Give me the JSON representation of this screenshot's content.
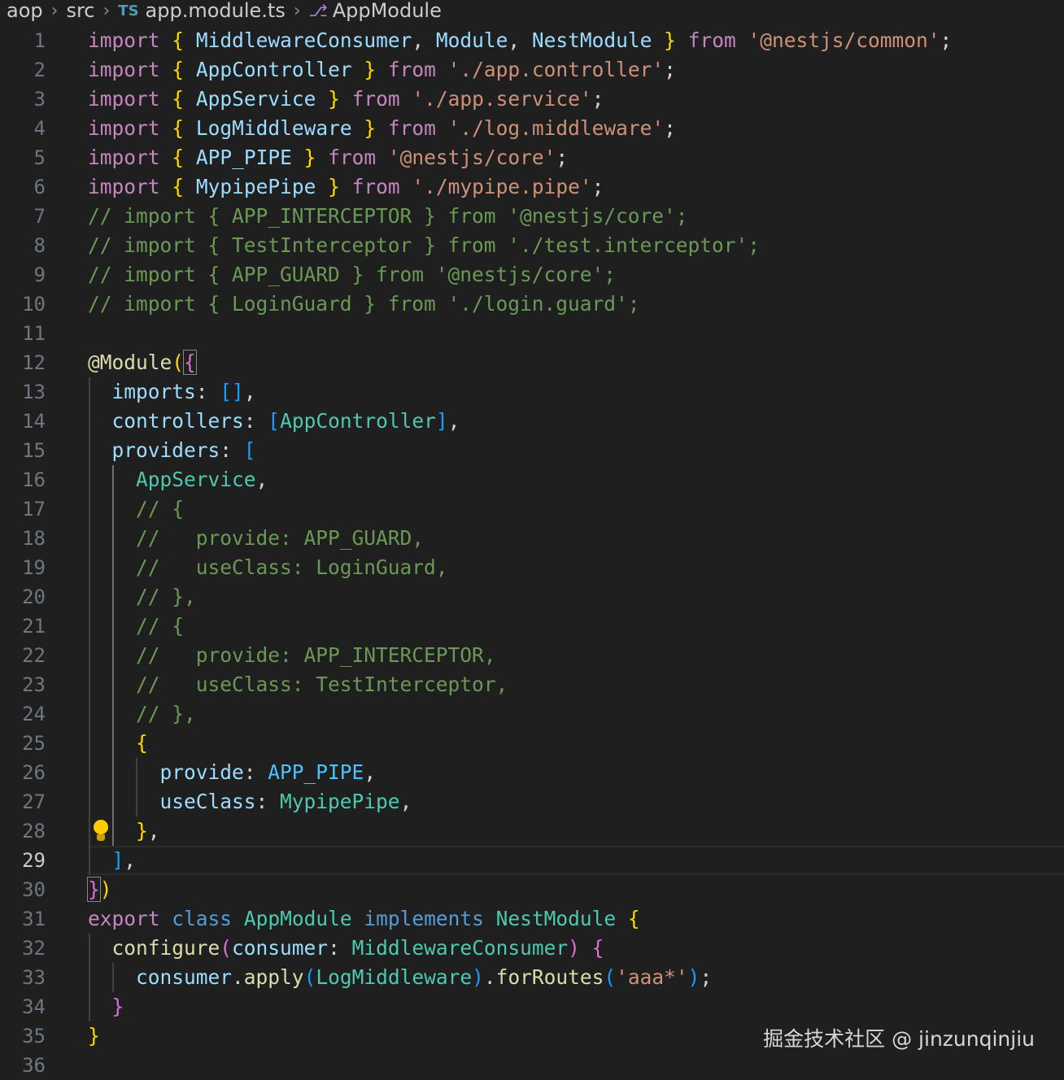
{
  "breadcrumb": {
    "items": [
      "aop",
      "src",
      "app.module.ts",
      "AppModule"
    ],
    "separator": ">",
    "file_badge": "TS"
  },
  "editor": {
    "current_line": 29,
    "lightbulb_line": 28,
    "colors": {
      "background": "#1f1f1f",
      "keyword": "#c586c0",
      "type": "#4ec9b0",
      "variable": "#9cdcfe",
      "string": "#ce9178",
      "comment": "#6a9955",
      "function": "#dcdcaa"
    },
    "lines": [
      {
        "n": 1,
        "tokens": [
          [
            "k",
            "import"
          ],
          [
            "d",
            " "
          ],
          [
            "b1",
            "{"
          ],
          [
            "d",
            " "
          ],
          [
            "v",
            "MiddlewareConsumer"
          ],
          [
            "d",
            ", "
          ],
          [
            "v",
            "Module"
          ],
          [
            "d",
            ", "
          ],
          [
            "v",
            "NestModule"
          ],
          [
            "d",
            " "
          ],
          [
            "b1",
            "}"
          ],
          [
            "d",
            " "
          ],
          [
            "k",
            "from"
          ],
          [
            "d",
            " "
          ],
          [
            "s",
            "'@nestjs/common'"
          ],
          [
            "d",
            ";"
          ]
        ]
      },
      {
        "n": 2,
        "tokens": [
          [
            "k",
            "import"
          ],
          [
            "d",
            " "
          ],
          [
            "b1",
            "{"
          ],
          [
            "d",
            " "
          ],
          [
            "v",
            "AppController"
          ],
          [
            "d",
            " "
          ],
          [
            "b1",
            "}"
          ],
          [
            "d",
            " "
          ],
          [
            "k",
            "from"
          ],
          [
            "d",
            " "
          ],
          [
            "s",
            "'./app.controller'"
          ],
          [
            "d",
            ";"
          ]
        ]
      },
      {
        "n": 3,
        "tokens": [
          [
            "k",
            "import"
          ],
          [
            "d",
            " "
          ],
          [
            "b1",
            "{"
          ],
          [
            "d",
            " "
          ],
          [
            "v",
            "AppService"
          ],
          [
            "d",
            " "
          ],
          [
            "b1",
            "}"
          ],
          [
            "d",
            " "
          ],
          [
            "k",
            "from"
          ],
          [
            "d",
            " "
          ],
          [
            "s",
            "'./app.service'"
          ],
          [
            "d",
            ";"
          ]
        ]
      },
      {
        "n": 4,
        "tokens": [
          [
            "k",
            "import"
          ],
          [
            "d",
            " "
          ],
          [
            "b1",
            "{"
          ],
          [
            "d",
            " "
          ],
          [
            "v",
            "LogMiddleware"
          ],
          [
            "d",
            " "
          ],
          [
            "b1",
            "}"
          ],
          [
            "d",
            " "
          ],
          [
            "k",
            "from"
          ],
          [
            "d",
            " "
          ],
          [
            "s",
            "'./log.middleware'"
          ],
          [
            "d",
            ";"
          ]
        ]
      },
      {
        "n": 5,
        "tokens": [
          [
            "k",
            "import"
          ],
          [
            "d",
            " "
          ],
          [
            "b1",
            "{"
          ],
          [
            "d",
            " "
          ],
          [
            "v",
            "APP_PIPE"
          ],
          [
            "d",
            " "
          ],
          [
            "b1",
            "}"
          ],
          [
            "d",
            " "
          ],
          [
            "k",
            "from"
          ],
          [
            "d",
            " "
          ],
          [
            "s",
            "'@nestjs/core'"
          ],
          [
            "d",
            ";"
          ]
        ]
      },
      {
        "n": 6,
        "tokens": [
          [
            "k",
            "import"
          ],
          [
            "d",
            " "
          ],
          [
            "b1",
            "{"
          ],
          [
            "d",
            " "
          ],
          [
            "v",
            "MypipePipe"
          ],
          [
            "d",
            " "
          ],
          [
            "b1",
            "}"
          ],
          [
            "d",
            " "
          ],
          [
            "k",
            "from"
          ],
          [
            "d",
            " "
          ],
          [
            "s",
            "'./mypipe.pipe'"
          ],
          [
            "d",
            ";"
          ]
        ]
      },
      {
        "n": 7,
        "tokens": [
          [
            "cm",
            "// import { APP_INTERCEPTOR } from '@nestjs/core';"
          ]
        ]
      },
      {
        "n": 8,
        "tokens": [
          [
            "cm",
            "// import { TestInterceptor } from './test.interceptor';"
          ]
        ]
      },
      {
        "n": 9,
        "tokens": [
          [
            "cm",
            "// import { APP_GUARD } from '@nestjs/core';"
          ]
        ]
      },
      {
        "n": 10,
        "tokens": [
          [
            "cm",
            "// import { LoginGuard } from './login.guard';"
          ]
        ]
      },
      {
        "n": 11,
        "tokens": []
      },
      {
        "n": 12,
        "tokens": [
          [
            "f",
            "@Module"
          ],
          [
            "b1",
            "("
          ],
          [
            "b2 match",
            "{"
          ]
        ]
      },
      {
        "n": 13,
        "guides": [
          1
        ],
        "tokens": [
          [
            "d",
            "  "
          ],
          [
            "v",
            "imports"
          ],
          [
            "d",
            ": "
          ],
          [
            "b3",
            "[]"
          ],
          [
            "d",
            ","
          ]
        ]
      },
      {
        "n": 14,
        "guides": [
          1
        ],
        "tokens": [
          [
            "d",
            "  "
          ],
          [
            "v",
            "controllers"
          ],
          [
            "d",
            ": "
          ],
          [
            "b3",
            "["
          ],
          [
            "t",
            "AppController"
          ],
          [
            "b3",
            "]"
          ],
          [
            "d",
            ","
          ]
        ]
      },
      {
        "n": 15,
        "guides": [
          1
        ],
        "tokens": [
          [
            "d",
            "  "
          ],
          [
            "v",
            "providers"
          ],
          [
            "d",
            ": "
          ],
          [
            "b3",
            "["
          ]
        ]
      },
      {
        "n": 16,
        "guides": [
          1,
          2
        ],
        "tokens": [
          [
            "d",
            "    "
          ],
          [
            "t",
            "AppService"
          ],
          [
            "d",
            ","
          ]
        ]
      },
      {
        "n": 17,
        "guides": [
          1,
          2
        ],
        "tokens": [
          [
            "d",
            "    "
          ],
          [
            "cm",
            "// {"
          ]
        ]
      },
      {
        "n": 18,
        "guides": [
          1,
          2
        ],
        "tokens": [
          [
            "d",
            "    "
          ],
          [
            "cm",
            "//   provide: APP_GUARD,"
          ]
        ]
      },
      {
        "n": 19,
        "guides": [
          1,
          2
        ],
        "tokens": [
          [
            "d",
            "    "
          ],
          [
            "cm",
            "//   useClass: LoginGuard,"
          ]
        ]
      },
      {
        "n": 20,
        "guides": [
          1,
          2
        ],
        "tokens": [
          [
            "d",
            "    "
          ],
          [
            "cm",
            "// },"
          ]
        ]
      },
      {
        "n": 21,
        "guides": [
          1,
          2
        ],
        "tokens": [
          [
            "d",
            "    "
          ],
          [
            "cm",
            "// {"
          ]
        ]
      },
      {
        "n": 22,
        "guides": [
          1,
          2
        ],
        "tokens": [
          [
            "d",
            "    "
          ],
          [
            "cm",
            "//   provide: APP_INTERCEPTOR,"
          ]
        ]
      },
      {
        "n": 23,
        "guides": [
          1,
          2
        ],
        "tokens": [
          [
            "d",
            "    "
          ],
          [
            "cm",
            "//   useClass: TestInterceptor,"
          ]
        ]
      },
      {
        "n": 24,
        "guides": [
          1,
          2
        ],
        "tokens": [
          [
            "d",
            "    "
          ],
          [
            "cm",
            "// },"
          ]
        ]
      },
      {
        "n": 25,
        "guides": [
          1,
          2
        ],
        "tokens": [
          [
            "d",
            "    "
          ],
          [
            "b1",
            "{"
          ]
        ]
      },
      {
        "n": 26,
        "guides": [
          1,
          2,
          3
        ],
        "tokens": [
          [
            "d",
            "      "
          ],
          [
            "v",
            "provide"
          ],
          [
            "d",
            ": "
          ],
          [
            "c",
            "APP_PIPE"
          ],
          [
            "d",
            ","
          ]
        ]
      },
      {
        "n": 27,
        "guides": [
          1,
          2,
          3
        ],
        "tokens": [
          [
            "d",
            "      "
          ],
          [
            "v",
            "useClass"
          ],
          [
            "d",
            ": "
          ],
          [
            "t",
            "MypipePipe"
          ],
          [
            "d",
            ","
          ]
        ]
      },
      {
        "n": 28,
        "guides": [
          1,
          2
        ],
        "tokens": [
          [
            "d",
            "    "
          ],
          [
            "b1",
            "}"
          ],
          [
            "d",
            ","
          ]
        ]
      },
      {
        "n": 29,
        "guides": [
          1
        ],
        "tokens": [
          [
            "d",
            "  "
          ],
          [
            "b3",
            "]"
          ],
          [
            "d",
            ","
          ]
        ]
      },
      {
        "n": 30,
        "tokens": [
          [
            "b2 match",
            "}"
          ],
          [
            "b1",
            ")"
          ]
        ]
      },
      {
        "n": 31,
        "tokens": [
          [
            "k",
            "export"
          ],
          [
            "d",
            " "
          ],
          [
            "kb",
            "class"
          ],
          [
            "d",
            " "
          ],
          [
            "t",
            "AppModule"
          ],
          [
            "d",
            " "
          ],
          [
            "kb",
            "implements"
          ],
          [
            "d",
            " "
          ],
          [
            "t",
            "NestModule"
          ],
          [
            "d",
            " "
          ],
          [
            "b1",
            "{"
          ]
        ]
      },
      {
        "n": 32,
        "guides": [
          1
        ],
        "tokens": [
          [
            "d",
            "  "
          ],
          [
            "f",
            "configure"
          ],
          [
            "b2",
            "("
          ],
          [
            "v",
            "consumer"
          ],
          [
            "d",
            ": "
          ],
          [
            "t",
            "MiddlewareConsumer"
          ],
          [
            "b2",
            ")"
          ],
          [
            "d",
            " "
          ],
          [
            "b2",
            "{"
          ]
        ]
      },
      {
        "n": 33,
        "guides": [
          1,
          2
        ],
        "tokens": [
          [
            "d",
            "    "
          ],
          [
            "v",
            "consumer"
          ],
          [
            "d",
            "."
          ],
          [
            "f",
            "apply"
          ],
          [
            "b3",
            "("
          ],
          [
            "t",
            "LogMiddleware"
          ],
          [
            "b3",
            ")"
          ],
          [
            "d",
            "."
          ],
          [
            "f",
            "forRoutes"
          ],
          [
            "b3",
            "("
          ],
          [
            "s",
            "'aaa*'"
          ],
          [
            "b3",
            ")"
          ],
          [
            "d",
            ";"
          ]
        ]
      },
      {
        "n": 34,
        "guides": [
          1
        ],
        "tokens": [
          [
            "d",
            "  "
          ],
          [
            "b2",
            "}"
          ]
        ]
      },
      {
        "n": 35,
        "tokens": [
          [
            "b1",
            "}"
          ]
        ]
      },
      {
        "n": 36,
        "tokens": []
      }
    ]
  },
  "watermark": "掘金技术社区 @ jinzunqinjiu"
}
